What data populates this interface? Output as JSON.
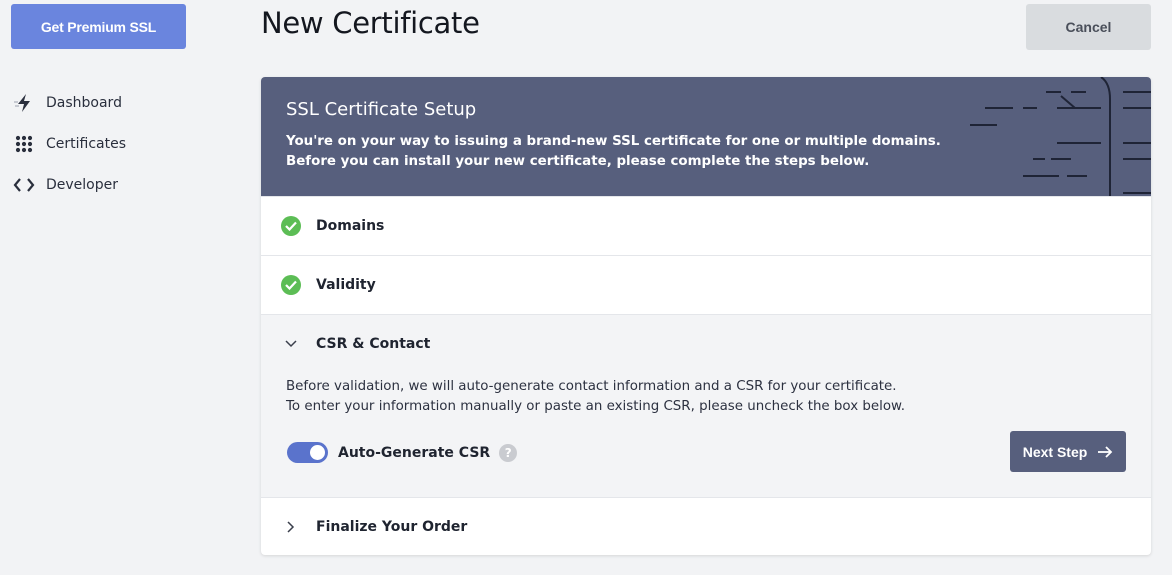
{
  "sidebar": {
    "premium_label": "Get Premium SSL",
    "items": [
      {
        "label": "Dashboard",
        "icon": "lightning-icon"
      },
      {
        "label": "Certificates",
        "icon": "grid-dots-icon"
      },
      {
        "label": "Developer",
        "icon": "code-brackets-icon"
      }
    ]
  },
  "header": {
    "title": "New Certificate",
    "cancel_label": "Cancel"
  },
  "banner": {
    "title": "SSL Certificate Setup",
    "line1": "You're on your way to issuing a brand-new SSL certificate for one or multiple domains.",
    "line2": "Before you can install your new certificate, please complete the steps below."
  },
  "steps": [
    {
      "label": "Domains",
      "state": "complete"
    },
    {
      "label": "Validity",
      "state": "complete"
    },
    {
      "label": "CSR & Contact",
      "state": "expanded"
    },
    {
      "label": "Finalize Your Order",
      "state": "collapsed"
    }
  ],
  "csr": {
    "line1": "Before validation, we will auto-generate contact information and a CSR for your certificate.",
    "line2": "To enter your information manually or paste an existing CSR, please uncheck the box below.",
    "toggle_label": "Auto-Generate CSR",
    "toggle_on": true,
    "help_glyph": "?",
    "next_label": "Next Step"
  },
  "colors": {
    "accent": "#6a85de",
    "banner": "#575f7d",
    "success": "#5cbd55",
    "toggle": "#5a73cc"
  }
}
